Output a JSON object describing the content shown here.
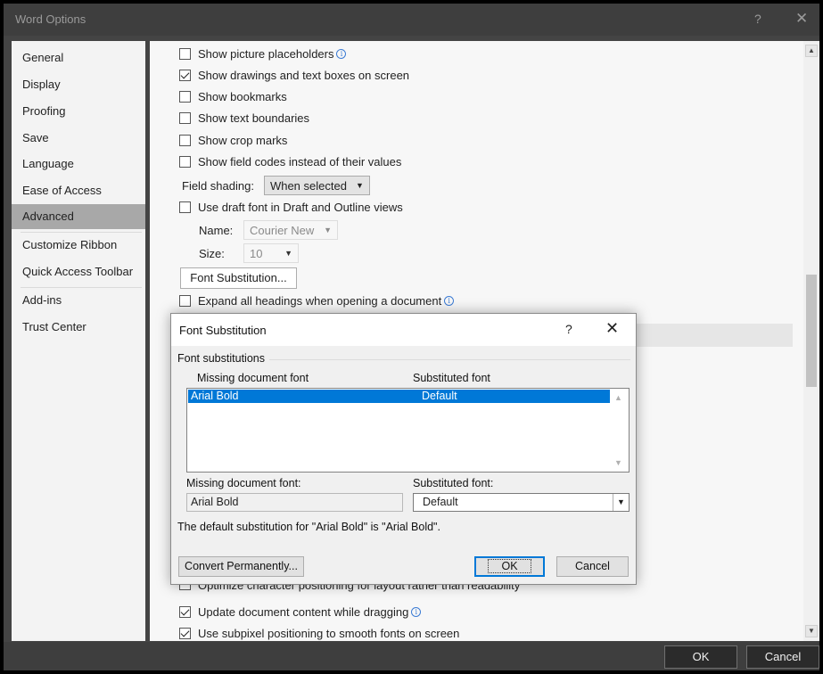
{
  "window": {
    "title": "Word Options",
    "help_glyph": "?",
    "close_glyph": "✕"
  },
  "sidebar": {
    "items": [
      {
        "label": "General"
      },
      {
        "label": "Display"
      },
      {
        "label": "Proofing"
      },
      {
        "label": "Save"
      },
      {
        "label": "Language"
      },
      {
        "label": "Ease of Access"
      },
      {
        "label": "Advanced",
        "selected": true
      },
      {
        "label": "Customize Ribbon"
      },
      {
        "label": "Quick Access Toolbar"
      },
      {
        "label": "Add-ins"
      },
      {
        "label": "Trust Center"
      }
    ]
  },
  "options": {
    "show_picture_placeholders": {
      "label": "Show picture placeholders",
      "checked": false
    },
    "show_drawings": {
      "label": "Show drawings and text boxes on screen",
      "checked": true
    },
    "show_bookmarks": {
      "label": "Show bookmarks",
      "checked": false
    },
    "show_text_boundaries": {
      "label": "Show text boundaries",
      "checked": false
    },
    "show_crop_marks": {
      "label": "Show crop marks",
      "checked": false
    },
    "show_field_codes": {
      "label": "Show field codes instead of their values",
      "checked": false
    },
    "field_shading": {
      "label": "Field shading:",
      "value": "When selected"
    },
    "use_draft_font": {
      "label": "Use draft font in Draft and Outline views",
      "checked": false
    },
    "draft_name": {
      "label": "Name:",
      "value": "Courier New"
    },
    "draft_size": {
      "label": "Size:",
      "value": "10"
    },
    "font_substitution_button": "Font Substitution...",
    "expand_headings": {
      "label": "Expand all headings when opening a document",
      "checked": false
    },
    "optimize_character": {
      "label": "Optimize character positioning for layout rather than readability",
      "checked": false
    },
    "update_content_dragging": {
      "label": "Update document content while dragging",
      "checked": true
    },
    "subpixel_positioning": {
      "label": "Use subpixel positioning to smooth fonts on screen",
      "checked": true
    }
  },
  "footer": {
    "ok": "OK",
    "cancel": "Cancel"
  },
  "dialog": {
    "title": "Font Substitution",
    "help_glyph": "?",
    "close_glyph": "✕",
    "group_label": "Font substitutions",
    "col_missing": "Missing document font",
    "col_substituted": "Substituted font",
    "rows": [
      {
        "missing": "Arial Bold",
        "substituted": "Default",
        "selected": true
      }
    ],
    "missing_label": "Missing document font:",
    "missing_value": "Arial Bold",
    "substituted_label": "Substituted font:",
    "substituted_value": "Default",
    "note": "The default substitution for \"Arial Bold\" is \"Arial Bold\".",
    "convert_button": "Convert Permanently...",
    "ok_button": "OK",
    "cancel_button": "Cancel"
  },
  "colors": {
    "selection": "#0078d7",
    "info_icon": "#3b7bd4",
    "sidebar_selected": "#a8a8a8"
  }
}
